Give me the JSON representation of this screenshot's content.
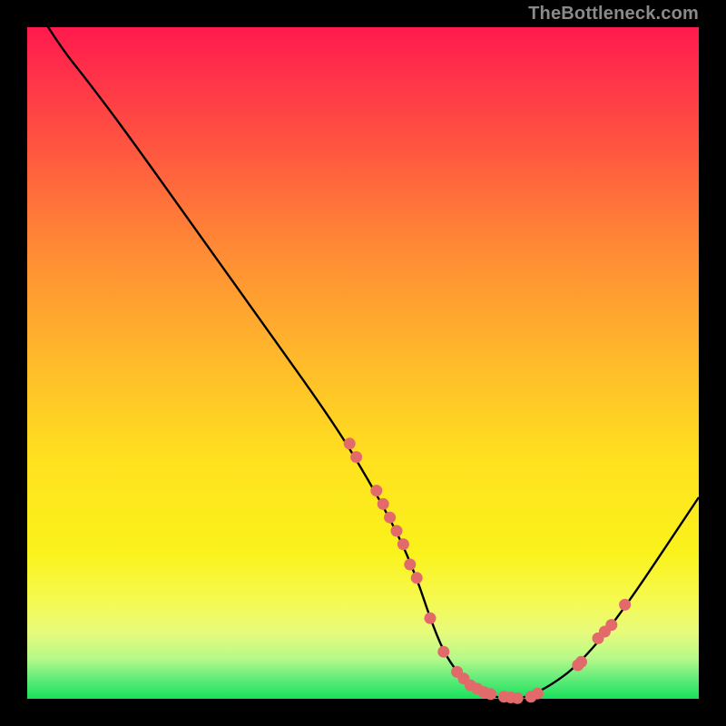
{
  "attribution": "TheBottleneck.com",
  "colors": {
    "bg": "#000000",
    "curve": "#000000",
    "dot": "#e26a6a",
    "gradient_stops": [
      "#ff1a4d",
      "#ff2e4a",
      "#ff5640",
      "#ff8a35",
      "#ffbb2a",
      "#ffe21f",
      "#faf21a",
      "#f6f94d",
      "#e8fb7b",
      "#b6f98a",
      "#63ec7a",
      "#17e05b"
    ]
  },
  "chart_data": {
    "type": "line",
    "title": "",
    "xlabel": "",
    "ylabel": "",
    "xlim": [
      0,
      100
    ],
    "ylim": [
      0,
      100
    ],
    "x": [
      0,
      5,
      9,
      15,
      25,
      35,
      45,
      50,
      55,
      58,
      60,
      62,
      64,
      66,
      70,
      74,
      78,
      82,
      88,
      100
    ],
    "values": [
      105,
      97,
      92,
      84,
      70,
      56,
      42,
      34,
      25,
      18,
      12,
      7,
      4,
      2,
      0,
      0,
      2,
      5,
      12,
      30
    ],
    "series": [
      {
        "name": "curve",
        "x": [
          0,
          5,
          9,
          15,
          25,
          35,
          45,
          50,
          55,
          58,
          60,
          62,
          64,
          66,
          70,
          74,
          78,
          82,
          88,
          100
        ],
        "values": [
          105,
          97,
          92,
          84,
          70,
          56,
          42,
          34,
          25,
          18,
          12,
          7,
          4,
          2,
          0,
          0,
          2,
          5,
          12,
          30
        ]
      },
      {
        "name": "dots",
        "x": [
          48,
          49,
          52,
          53,
          54,
          55,
          56,
          57,
          58,
          60,
          62,
          64,
          65,
          66,
          67,
          68,
          69,
          71,
          72,
          73,
          75,
          76,
          82,
          82.5,
          85,
          86,
          87,
          89
        ],
        "values": [
          38,
          36,
          31,
          29,
          27,
          25,
          23,
          20,
          18,
          12,
          7,
          4,
          3,
          2,
          1.5,
          1,
          0.7,
          0.3,
          0.2,
          0.1,
          0.3,
          0.8,
          5,
          5.5,
          9,
          10,
          11,
          14
        ]
      }
    ],
    "notes": "x and values are approximate percentages read from the plot; the curve descends steeply from top-left, reaches a flat minimum near x≈70–74, then rises toward the right edge. Dots mark sampled points along the lower portion of the curve."
  }
}
